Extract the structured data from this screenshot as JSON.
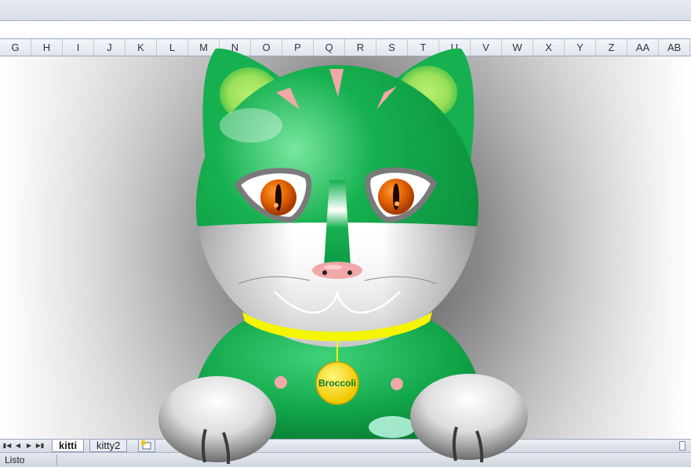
{
  "columns": [
    "G",
    "H",
    "I",
    "J",
    "K",
    "L",
    "M",
    "N",
    "O",
    "P",
    "Q",
    "R",
    "S",
    "T",
    "U",
    "V",
    "W",
    "X",
    "Y",
    "Z",
    "AA",
    "AB"
  ],
  "sheet_tabs": [
    {
      "label": "kitti",
      "active": true
    },
    {
      "label": "kitty2",
      "active": false
    }
  ],
  "status": {
    "mode": "Listo"
  },
  "artwork": {
    "tag_label": "Broccoli",
    "colors": {
      "fur_green": "#12a84a",
      "ear_inner": "#9be05a",
      "collar": "#f5f500",
      "tag": "#ffe000",
      "iris": "#e06000",
      "nose": "#f0a8a8"
    }
  }
}
